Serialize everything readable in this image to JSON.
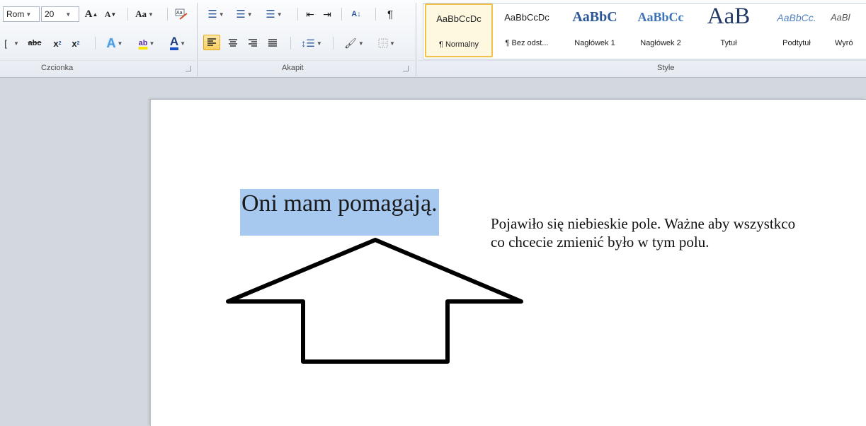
{
  "ribbon": {
    "font": {
      "name_value": "Rom",
      "size_value": "20",
      "group_label": "Czcionka",
      "grow_label": "A",
      "shrink_label": "A",
      "case_label": "Aa",
      "strike_label": "abc",
      "sub_label": "x",
      "sup_label": "x",
      "underline_partial": "[",
      "color_letter": "A",
      "highlight_letter": "ab"
    },
    "paragraph": {
      "group_label": "Akapit",
      "sort_label": "A↓",
      "pilcrow": "¶"
    },
    "styles": {
      "group_label": "Style",
      "items": [
        {
          "sample": "AaBbCcDc",
          "name": "¶ Normalny"
        },
        {
          "sample": "AaBbCcDc",
          "name": "¶ Bez odst..."
        },
        {
          "sample": "AaBbC",
          "name": "Nagłówek 1"
        },
        {
          "sample": "AaBbCc",
          "name": "Nagłówek 2"
        },
        {
          "sample": "AaB",
          "name": "Tytuł"
        },
        {
          "sample": "AaBbCc.",
          "name": "Podtytuł"
        },
        {
          "sample": "AaBl",
          "name": "Wyró"
        }
      ]
    }
  },
  "document": {
    "selected_text": "Oni mam pomagają.",
    "note_text": "Pojawiło się niebieskie pole. Ważne aby wszystkco co chcecie zmienić było w tym polu."
  },
  "colors": {
    "selection": "#a7c8ef",
    "active_button": "#f9cf5c",
    "heading_style": "#2b5797"
  }
}
